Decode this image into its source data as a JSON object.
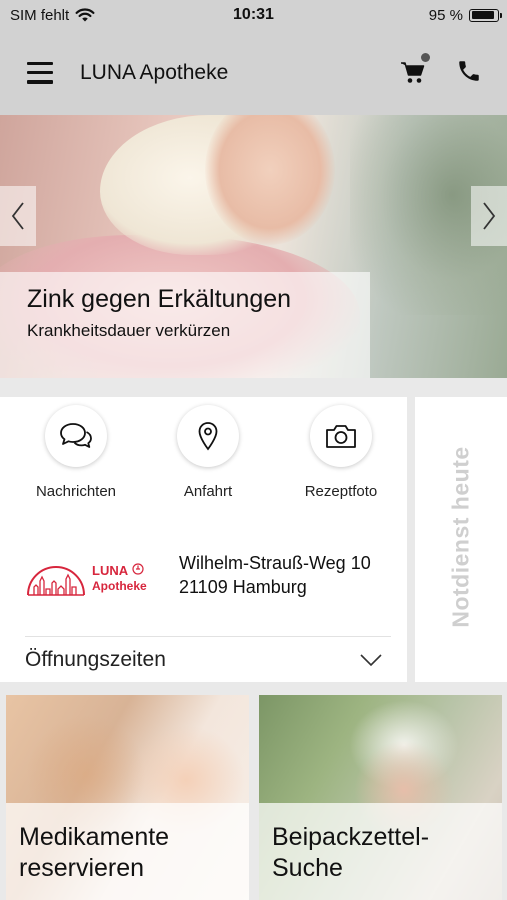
{
  "status_bar": {
    "carrier": "SIM fehlt",
    "time": "10:31",
    "battery_percent": "95 %",
    "battery_level": 0.95
  },
  "nav": {
    "title": "LUNA Apotheke",
    "icons": [
      "menu-icon",
      "cart-icon",
      "phone-icon"
    ]
  },
  "hero": {
    "title": "Zink gegen Erkältungen",
    "subtitle": "Krankheitsdauer verkürzen"
  },
  "actions": [
    {
      "label": "Nachrichten",
      "icon": "chat-icon"
    },
    {
      "label": "Anfahrt",
      "icon": "location-pin-icon"
    },
    {
      "label": "Rezeptfoto",
      "icon": "camera-icon"
    }
  ],
  "pharmacy": {
    "logo_name": "LUNA",
    "logo_sub": "Apotheke",
    "street": "Wilhelm-Strauß-Weg 10",
    "city": "21109 Hamburg",
    "hours_label": "Öffnungszeiten"
  },
  "side_panel": {
    "label": "Notdienst heute"
  },
  "tiles": [
    {
      "label": "Medikamente\nreservieren"
    },
    {
      "label": "Beipackzettel-\nSuche"
    }
  ],
  "colors": {
    "brand_red": "#d7263d",
    "bar_gray": "#d2d2d2",
    "panel_text_gray": "#cfcfcf"
  }
}
